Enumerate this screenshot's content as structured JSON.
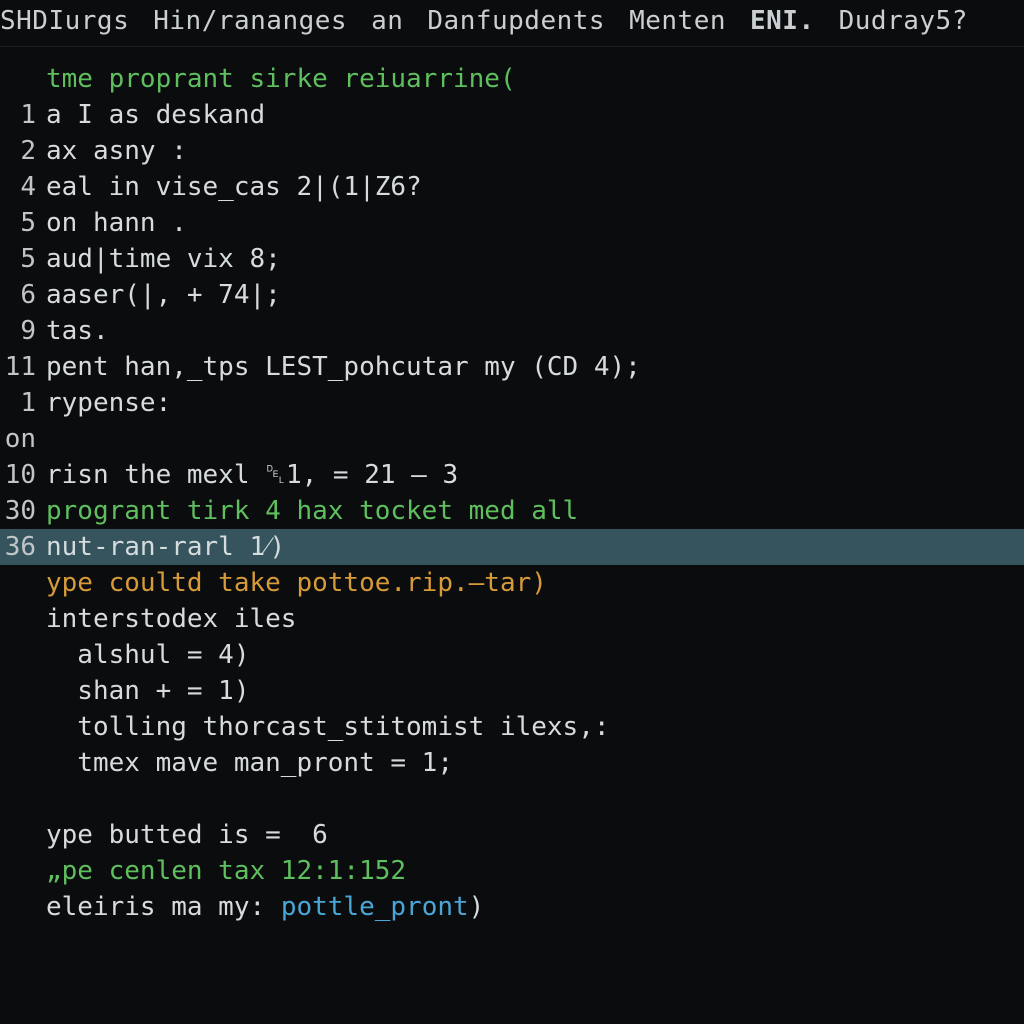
{
  "menubar": {
    "items": [
      "SHDIurgs",
      "Hin/rananges",
      "an",
      "Danfupdents",
      "Menten",
      "ENI.",
      "Dudray5?"
    ],
    "bold_index": 5
  },
  "lines": [
    {
      "no": "",
      "highlight": false,
      "segments": [
        {
          "cls": "tok-green",
          "t": "tme proprant sirke reiuarrine("
        }
      ]
    },
    {
      "no": "1",
      "highlight": false,
      "segments": [
        {
          "cls": "",
          "t": "a I as deskand"
        }
      ]
    },
    {
      "no": "2",
      "highlight": false,
      "segments": [
        {
          "cls": "",
          "t": "ax asny :"
        }
      ]
    },
    {
      "no": "4",
      "highlight": false,
      "segments": [
        {
          "cls": "",
          "t": "eal in vise_cas 2|(1|Z6?"
        }
      ]
    },
    {
      "no": "5",
      "highlight": false,
      "segments": [
        {
          "cls": "",
          "t": "on hann ."
        }
      ]
    },
    {
      "no": "5",
      "highlight": false,
      "segments": [
        {
          "cls": "",
          "t": "aud|time vix 8;"
        }
      ]
    },
    {
      "no": "6",
      "highlight": false,
      "segments": [
        {
          "cls": "",
          "t": "aaser(|, + 74|;"
        }
      ]
    },
    {
      "no": "9",
      "highlight": false,
      "segments": [
        {
          "cls": "",
          "t": "tas."
        }
      ]
    },
    {
      "no": "11",
      "highlight": false,
      "segments": [
        {
          "cls": "",
          "t": "pent han,_tps LEST_pohcutar my (CD 4);"
        }
      ]
    },
    {
      "no": "1",
      "highlight": false,
      "segments": [
        {
          "cls": "",
          "t": "rypense:"
        }
      ]
    },
    {
      "no": "on",
      "highlight": false,
      "segments": [
        {
          "cls": "",
          "t": ""
        }
      ]
    },
    {
      "no": "10",
      "highlight": false,
      "segments": [
        {
          "cls": "",
          "t": "risn the mexl ␡1, = 21 – 3"
        }
      ]
    },
    {
      "no": "30",
      "highlight": false,
      "segments": [
        {
          "cls": "tok-green",
          "t": "progrant tirk 4 hax tocket med all"
        }
      ]
    },
    {
      "no": "36",
      "highlight": true,
      "segments": [
        {
          "cls": "",
          "t": "nut-ran-rarl 1⁄)"
        }
      ]
    },
    {
      "no": "",
      "highlight": false,
      "segments": [
        {
          "cls": "tok-orange",
          "t": "ype coultd take pottoe.rip.–tar)"
        }
      ]
    },
    {
      "no": "",
      "highlight": false,
      "segments": [
        {
          "cls": "",
          "t": "interstodex iles"
        }
      ]
    },
    {
      "no": "",
      "highlight": false,
      "segments": [
        {
          "cls": "",
          "t": "  alshul = 4)"
        }
      ]
    },
    {
      "no": "",
      "highlight": false,
      "segments": [
        {
          "cls": "",
          "t": "  shan + = 1)"
        }
      ]
    },
    {
      "no": "",
      "highlight": false,
      "segments": [
        {
          "cls": "",
          "t": "  tolling thorcast_stitomist ilexs,:"
        }
      ]
    },
    {
      "no": "",
      "highlight": false,
      "segments": [
        {
          "cls": "",
          "t": "  tmex mave man_pront = 1;"
        }
      ]
    },
    {
      "no": "",
      "highlight": false,
      "segments": [
        {
          "cls": "",
          "t": ""
        }
      ]
    },
    {
      "no": "",
      "highlight": false,
      "segments": [
        {
          "cls": "",
          "t": "ype butted is =  6"
        }
      ]
    },
    {
      "no": "",
      "highlight": false,
      "segments": [
        {
          "cls": "tok-green",
          "t": "„pe cenlen tax 12:1:152"
        }
      ]
    },
    {
      "no": "",
      "highlight": false,
      "segments": [
        {
          "cls": "",
          "t": "eleiris ma my: "
        },
        {
          "cls": "tok-blue",
          "t": "pottle_pront"
        },
        {
          "cls": "",
          "t": ")"
        }
      ]
    }
  ]
}
